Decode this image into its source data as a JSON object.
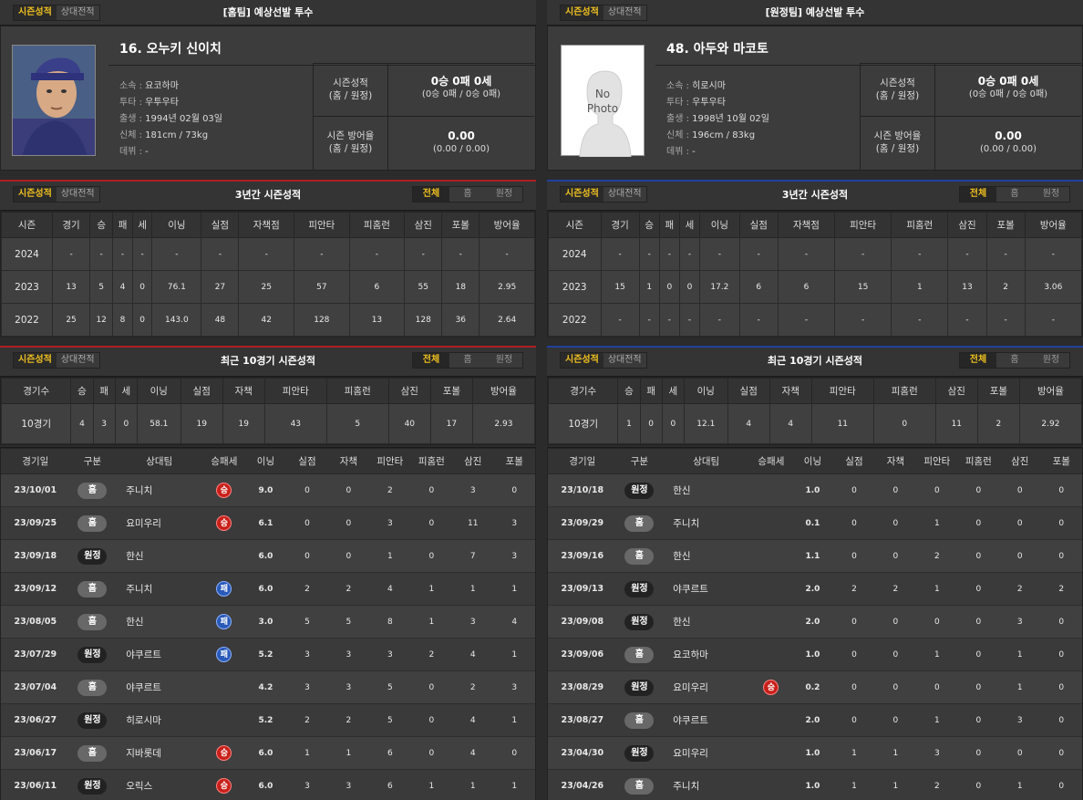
{
  "left": {
    "accent": "#b02020",
    "tabs": [
      "시즌성적",
      "상대전적"
    ],
    "header_title": "[홈팀] 예상선발 투수",
    "player": {
      "name": "16. 오누키 신이치",
      "team": "요코하마",
      "throwbat": "우투우타",
      "birth": "1994년 02월 03일",
      "body": "181cm / 73kg",
      "debut": "-"
    },
    "labels": {
      "team": "소속 : ",
      "throwbat": "투타 : ",
      "birth": "출생 : ",
      "body": "신체 : ",
      "debut": "데뷔 : "
    },
    "season_record_label": [
      "시즌성적",
      "(홈 / 원정)"
    ],
    "season_record": "0승 0패 0세",
    "season_record_sub": "(0승 0패 / 0승 0패)",
    "season_era_label": [
      "시즌 방어율",
      "(홈 / 원정)"
    ],
    "season_era": "0.00",
    "season_era_sub": "(0.00 / 0.00)",
    "three_title": "3년간 시즌성적",
    "filter_tabs": [
      "전체",
      "홈",
      "원정"
    ],
    "three_headers": [
      "시즌",
      "경기",
      "승",
      "패",
      "세",
      "이닝",
      "실점",
      "자책점",
      "피안타",
      "피홈런",
      "삼진",
      "포볼",
      "방어율"
    ],
    "three_rows": [
      [
        "2024",
        "-",
        "-",
        "-",
        "-",
        "-",
        "-",
        "-",
        "-",
        "-",
        "-",
        "-",
        "-"
      ],
      [
        "2023",
        "13",
        "5",
        "4",
        "0",
        "76.1",
        "27",
        "25",
        "57",
        "6",
        "55",
        "18",
        "2.95"
      ],
      [
        "2022",
        "25",
        "12",
        "8",
        "0",
        "143.0",
        "48",
        "42",
        "128",
        "13",
        "128",
        "36",
        "2.64"
      ]
    ],
    "recent_title": "최근 10경기 시즌성적",
    "recent_headers": [
      "경기수",
      "승",
      "패",
      "세",
      "이닝",
      "실점",
      "자책",
      "피안타",
      "피홈런",
      "삼진",
      "포볼",
      "방어율"
    ],
    "recent_row": [
      "10경기",
      "4",
      "3",
      "0",
      "58.1",
      "19",
      "19",
      "43",
      "5",
      "40",
      "17",
      "2.93"
    ],
    "game_headers": [
      "경기일",
      "구분",
      "상대팀",
      "승패세",
      "이닝",
      "실점",
      "자책",
      "피안타",
      "피홈런",
      "삼진",
      "포볼"
    ],
    "games": [
      [
        "23/10/01",
        "홈",
        "주니치",
        "승",
        "9.0",
        "0",
        "0",
        "2",
        "0",
        "3",
        "0"
      ],
      [
        "23/09/25",
        "홈",
        "요미우리",
        "승",
        "6.1",
        "0",
        "0",
        "3",
        "0",
        "11",
        "3"
      ],
      [
        "23/09/18",
        "원정",
        "한신",
        "",
        "6.0",
        "0",
        "0",
        "1",
        "0",
        "7",
        "3"
      ],
      [
        "23/09/12",
        "홈",
        "주니치",
        "패",
        "6.0",
        "2",
        "2",
        "4",
        "1",
        "1",
        "1"
      ],
      [
        "23/08/05",
        "홈",
        "한신",
        "패",
        "3.0",
        "5",
        "5",
        "8",
        "1",
        "3",
        "4"
      ],
      [
        "23/07/29",
        "원정",
        "야쿠르트",
        "패",
        "5.2",
        "3",
        "3",
        "3",
        "2",
        "4",
        "1"
      ],
      [
        "23/07/04",
        "홈",
        "야쿠르트",
        "",
        "4.2",
        "3",
        "3",
        "5",
        "0",
        "2",
        "3"
      ],
      [
        "23/06/27",
        "원정",
        "히로시마",
        "",
        "5.2",
        "2",
        "2",
        "5",
        "0",
        "4",
        "1"
      ],
      [
        "23/06/17",
        "홈",
        "지바롯데",
        "승",
        "6.0",
        "1",
        "1",
        "6",
        "0",
        "4",
        "0"
      ],
      [
        "23/06/11",
        "원정",
        "오릭스",
        "승",
        "6.0",
        "3",
        "3",
        "6",
        "1",
        "1",
        "1"
      ]
    ]
  },
  "right": {
    "accent": "#2040a0",
    "tabs": [
      "시즌성적",
      "상대전적"
    ],
    "header_title": "[원정팀] 예상선발 투수",
    "no_photo": [
      "No",
      "Photo"
    ],
    "player": {
      "name": "48. 아두와 마코토",
      "team": "히로시마",
      "throwbat": "우투우타",
      "birth": "1998년 10월 02일",
      "body": "196cm / 83kg",
      "debut": "-"
    },
    "labels": {
      "team": "소속 : ",
      "throwbat": "투타 : ",
      "birth": "출생 : ",
      "body": "신체 : ",
      "debut": "데뷔 : "
    },
    "season_record_label": [
      "시즌성적",
      "(홈 / 원정)"
    ],
    "season_record": "0승 0패 0세",
    "season_record_sub": "(0승 0패 / 0승 0패)",
    "season_era_label": [
      "시즌 방어율",
      "(홈 / 원정)"
    ],
    "season_era": "0.00",
    "season_era_sub": "(0.00 / 0.00)",
    "three_title": "3년간 시즌성적",
    "filter_tabs": [
      "전체",
      "홈",
      "원정"
    ],
    "three_headers": [
      "시즌",
      "경기",
      "승",
      "패",
      "세",
      "이닝",
      "실점",
      "자책점",
      "피안타",
      "피홈런",
      "삼진",
      "포볼",
      "방어율"
    ],
    "three_rows": [
      [
        "2024",
        "-",
        "-",
        "-",
        "-",
        "-",
        "-",
        "-",
        "-",
        "-",
        "-",
        "-",
        "-"
      ],
      [
        "2023",
        "15",
        "1",
        "0",
        "0",
        "17.2",
        "6",
        "6",
        "15",
        "1",
        "13",
        "2",
        "3.06"
      ],
      [
        "2022",
        "-",
        "-",
        "-",
        "-",
        "-",
        "-",
        "-",
        "-",
        "-",
        "-",
        "-",
        "-"
      ]
    ],
    "recent_title": "최근 10경기 시즌성적",
    "recent_headers": [
      "경기수",
      "승",
      "패",
      "세",
      "이닝",
      "실점",
      "자책",
      "피안타",
      "피홈런",
      "삼진",
      "포볼",
      "방어율"
    ],
    "recent_row": [
      "10경기",
      "1",
      "0",
      "0",
      "12.1",
      "4",
      "4",
      "11",
      "0",
      "11",
      "2",
      "2.92"
    ],
    "game_headers": [
      "경기일",
      "구분",
      "상대팀",
      "승패세",
      "이닝",
      "실점",
      "자책",
      "피안타",
      "피홈런",
      "삼진",
      "포볼"
    ],
    "games": [
      [
        "23/10/18",
        "원정",
        "한신",
        "",
        "1.0",
        "0",
        "0",
        "0",
        "0",
        "0",
        "0"
      ],
      [
        "23/09/29",
        "홈",
        "주니치",
        "",
        "0.1",
        "0",
        "0",
        "1",
        "0",
        "0",
        "0"
      ],
      [
        "23/09/16",
        "홈",
        "한신",
        "",
        "1.1",
        "0",
        "0",
        "2",
        "0",
        "0",
        "0"
      ],
      [
        "23/09/13",
        "원정",
        "야쿠르트",
        "",
        "2.0",
        "2",
        "2",
        "1",
        "0",
        "2",
        "2"
      ],
      [
        "23/09/08",
        "원정",
        "한신",
        "",
        "2.0",
        "0",
        "0",
        "0",
        "0",
        "3",
        "0"
      ],
      [
        "23/09/06",
        "홈",
        "요코하마",
        "",
        "1.0",
        "0",
        "0",
        "1",
        "0",
        "1",
        "0"
      ],
      [
        "23/08/29",
        "원정",
        "요미우리",
        "승",
        "0.2",
        "0",
        "0",
        "0",
        "0",
        "1",
        "0"
      ],
      [
        "23/08/27",
        "홈",
        "야쿠르트",
        "",
        "2.0",
        "0",
        "0",
        "1",
        "0",
        "3",
        "0"
      ],
      [
        "23/04/30",
        "원정",
        "요미우리",
        "",
        "1.0",
        "1",
        "1",
        "3",
        "0",
        "0",
        "0"
      ],
      [
        "23/04/26",
        "홈",
        "주니치",
        "",
        "1.0",
        "1",
        "1",
        "2",
        "0",
        "1",
        "0"
      ]
    ]
  }
}
